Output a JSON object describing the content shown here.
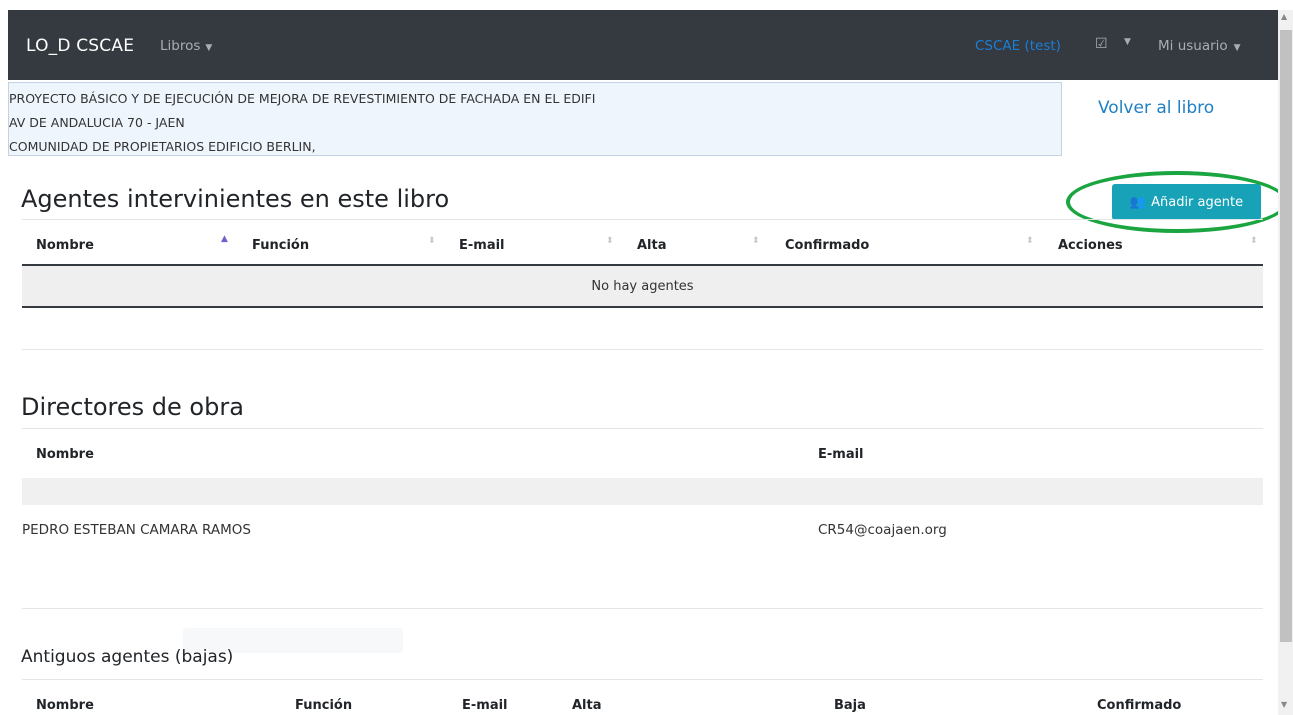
{
  "navbar": {
    "brand": "LO_D CSCAE",
    "libros": "Libros",
    "org": "CSCAE (test)",
    "check_icon": "☑",
    "user": "Mi usuario"
  },
  "project": {
    "line1": "PROYECTO BÁSICO Y DE EJECUCIÓN DE MEJORA DE REVESTIMIENTO DE FACHADA EN EL EDIFI",
    "line2": "AV DE ANDALUCIA 70 - JAEN",
    "line3": "COMUNIDAD DE PROPIETARIOS EDIFICIO BERLIN,"
  },
  "back_link": "Volver al libro",
  "agentes": {
    "title": "Agentes intervinientes en este libro",
    "add_button": "Añadir agente",
    "columns": [
      "Nombre",
      "Función",
      "E-mail",
      "Alta",
      "Confirmado",
      "Acciones"
    ],
    "empty": "No hay agentes"
  },
  "directores": {
    "title": "Directores de obra",
    "columns": [
      "Nombre",
      "E-mail"
    ],
    "rows": [
      {
        "nombre": "PEDRO ESTEBAN CAMARA RAMOS",
        "email": "CR54@coajaen.org"
      }
    ]
  },
  "antiguos": {
    "title": "Antiguos agentes (bajas)",
    "columns": [
      "Nombre",
      "Función",
      "E-mail",
      "Alta",
      "Baja",
      "Confirmado"
    ]
  },
  "colors": {
    "navbar_bg": "#343a40",
    "button_bg": "#17a2b8",
    "highlight": "#1aa541",
    "link": "#1f7fc4"
  }
}
